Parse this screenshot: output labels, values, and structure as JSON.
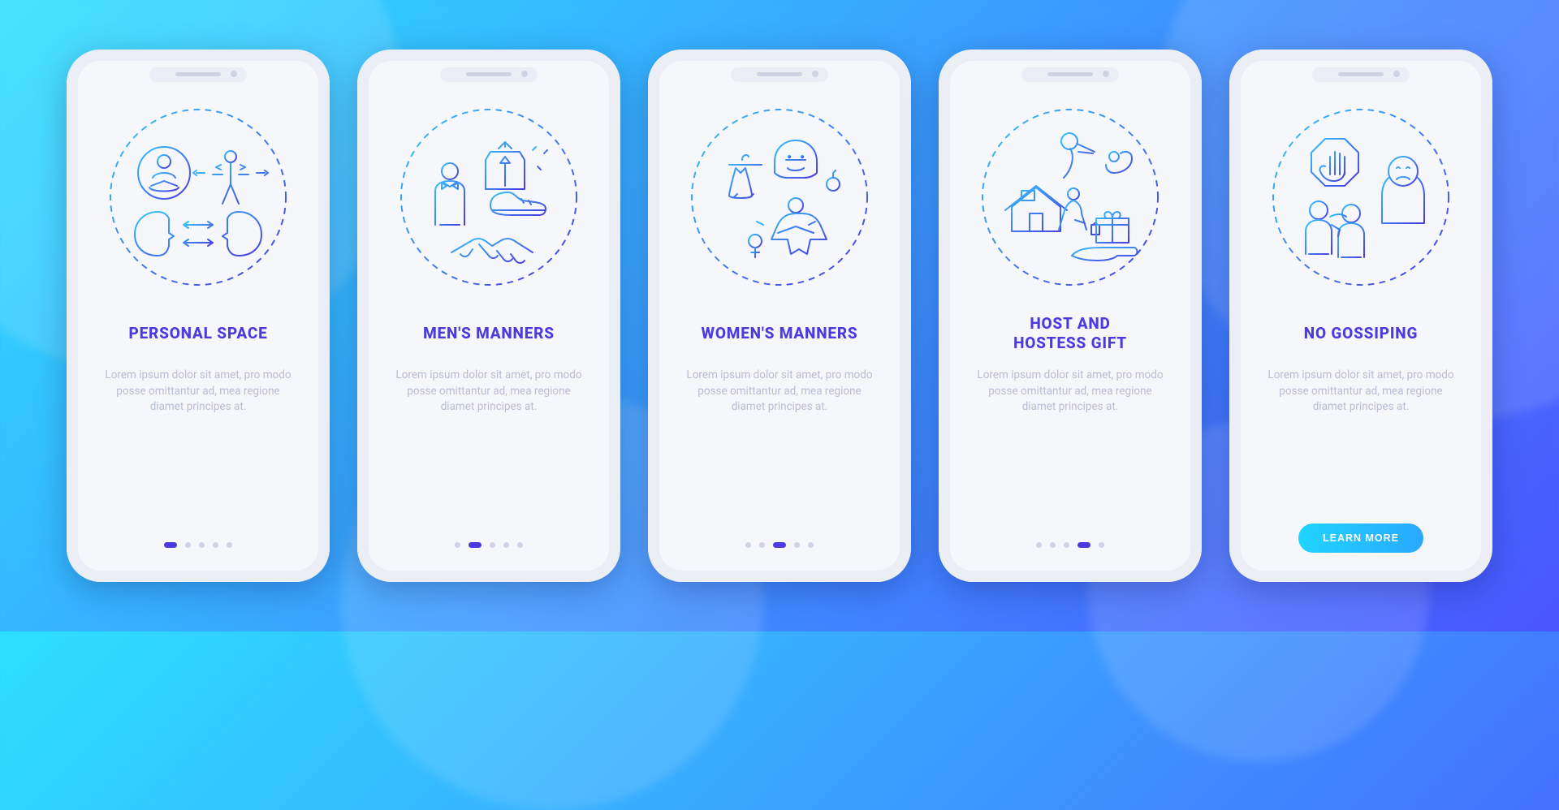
{
  "colors": {
    "title": "#4a3adf",
    "muted": "#b7bdd3",
    "gradientA": "#34c5ff",
    "gradientB": "#4a3adf"
  },
  "screens": [
    {
      "title": "PERSONAL SPACE",
      "body": "Lorem ipsum dolor sit amet, pro modo posse omittantur ad, mea regione diamet principes at.",
      "icon": "personal-space",
      "activeIndex": 0
    },
    {
      "title": "MEN'S MANNERS",
      "body": "Lorem ipsum dolor sit amet, pro modo posse omittantur ad, mea regione diamet principes at.",
      "icon": "mens-manners",
      "activeIndex": 1
    },
    {
      "title": "WOMEN'S MANNERS",
      "body": "Lorem ipsum dolor sit amet, pro modo posse omittantur ad, mea regione diamet principes at.",
      "icon": "womens-manners",
      "activeIndex": 2
    },
    {
      "title": "HOST AND\nHOSTESS GIFT",
      "body": "Lorem ipsum dolor sit amet, pro modo posse omittantur ad, mea regione diamet principes at.",
      "icon": "host-gift",
      "activeIndex": 3
    },
    {
      "title": "NO GOSSIPING",
      "body": "Lorem ipsum dolor sit amet, pro modo posse omittantur ad, mea regione diamet principes at.",
      "icon": "no-gossiping",
      "activeIndex": 4
    }
  ],
  "cta_label": "LEARN MORE",
  "total_dots": 5
}
